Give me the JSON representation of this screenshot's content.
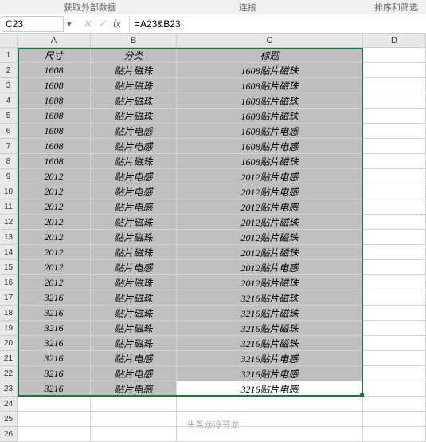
{
  "ribbon": {
    "group1": "获取外部数据",
    "group2": "连接",
    "group3": "排序和筛选"
  },
  "nameBox": "C23",
  "formula": "=A23&B23",
  "columns": [
    "A",
    "B",
    "C",
    "D"
  ],
  "headerRow": {
    "a": "尺寸",
    "b": "分类",
    "c": "标题"
  },
  "chart_data": {
    "type": "table",
    "columns": [
      "尺寸",
      "分类",
      "标题"
    ],
    "rows": [
      [
        "1608",
        "贴片磁珠",
        "1608贴片磁珠"
      ],
      [
        "1608",
        "贴片磁珠",
        "1608贴片磁珠"
      ],
      [
        "1608",
        "贴片磁珠",
        "1608贴片磁珠"
      ],
      [
        "1608",
        "贴片磁珠",
        "1608贴片磁珠"
      ],
      [
        "1608",
        "贴片电感",
        "1608贴片电感"
      ],
      [
        "1608",
        "贴片电感",
        "1608贴片电感"
      ],
      [
        "1608",
        "贴片磁珠",
        "1608贴片磁珠"
      ],
      [
        "2012",
        "贴片电感",
        "2012贴片电感"
      ],
      [
        "2012",
        "贴片电感",
        "2012贴片电感"
      ],
      [
        "2012",
        "贴片电感",
        "2012贴片电感"
      ],
      [
        "2012",
        "贴片磁珠",
        "2012贴片磁珠"
      ],
      [
        "2012",
        "贴片磁珠",
        "2012贴片磁珠"
      ],
      [
        "2012",
        "贴片磁珠",
        "2012贴片磁珠"
      ],
      [
        "2012",
        "贴片电感",
        "2012贴片电感"
      ],
      [
        "2012",
        "贴片磁珠",
        "2012贴片磁珠"
      ],
      [
        "3216",
        "贴片磁珠",
        "3216贴片磁珠"
      ],
      [
        "3216",
        "贴片磁珠",
        "3216贴片磁珠"
      ],
      [
        "3216",
        "贴片磁珠",
        "3216贴片磁珠"
      ],
      [
        "3216",
        "贴片磁珠",
        "3216贴片磁珠"
      ],
      [
        "3216",
        "贴片电感",
        "3216贴片电感"
      ],
      [
        "3216",
        "贴片电感",
        "3216贴片电感"
      ],
      [
        "3216",
        "贴片电感",
        "3216贴片电感"
      ]
    ]
  },
  "emptyRows": [
    "24",
    "25",
    "26"
  ],
  "watermark": "头条@冷芬龙"
}
